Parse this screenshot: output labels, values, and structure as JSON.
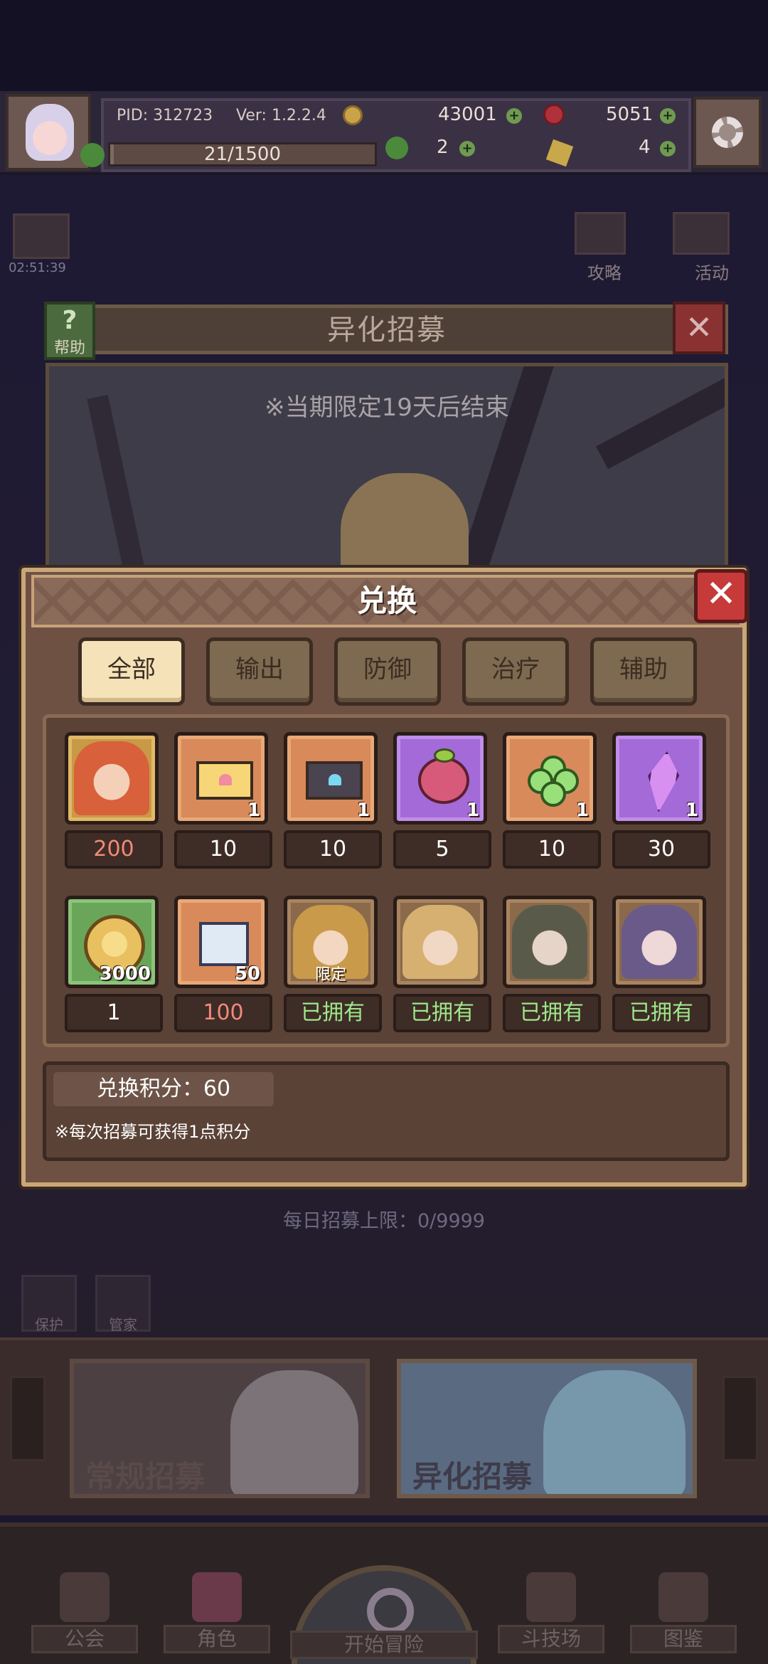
{
  "header": {
    "pid": "PID: 312723",
    "version": "Ver: 1.2.2.4",
    "gold": "43001",
    "gems": "5051",
    "exp": "21/1500",
    "exp_fraction": 0.014,
    "clover": "2",
    "key": "4"
  },
  "background": {
    "timer": "02:51:39",
    "guide_label": "攻略",
    "event_label": "活动",
    "recruit_title": "异化招募",
    "help_label": "帮助",
    "limited_notice": "※当期限定19天后结束",
    "daily_limit": "每日招募上限：0/9999",
    "left_btn_1": "保护",
    "left_btn_2": "管家",
    "banner_normal": "常规招募",
    "banner_special": "异化招募"
  },
  "nav": {
    "guild": "公会",
    "character": "角色",
    "adventure": "开始冒险",
    "arena": "斗技场",
    "codex": "图鉴"
  },
  "dialog": {
    "title": "兑换",
    "tabs": [
      "全部",
      "输出",
      "防御",
      "治疗",
      "辅助"
    ],
    "active_tab": "全部",
    "row1": [
      {
        "name": "character-portrait",
        "price": "200",
        "qty": ""
      },
      {
        "name": "love-letter",
        "price": "10",
        "qty": "1"
      },
      {
        "name": "dark-letter",
        "price": "10",
        "qty": "1"
      },
      {
        "name": "peach",
        "price": "5",
        "qty": "1"
      },
      {
        "name": "clover",
        "price": "10",
        "qty": "1"
      },
      {
        "name": "crystal",
        "price": "30",
        "qty": "1"
      }
    ],
    "row2": [
      {
        "name": "gold-coin",
        "price": "1",
        "qty": "3000"
      },
      {
        "name": "puzzle-scroll",
        "price": "100",
        "qty": "50"
      },
      {
        "name": "hero-goggles",
        "price": "已拥有",
        "tag": "限定"
      },
      {
        "name": "hero-blonde",
        "price": "已拥有"
      },
      {
        "name": "hero-dark",
        "price": "已拥有"
      },
      {
        "name": "hero-purple",
        "price": "已拥有"
      }
    ],
    "points_label": "兑换积分：60",
    "points_note": "※每次招募可获得1点积分"
  },
  "colors": {
    "accent_gold": "#c9a878",
    "owned_green": "#9ee88a",
    "price_red": "#f28a7a"
  }
}
